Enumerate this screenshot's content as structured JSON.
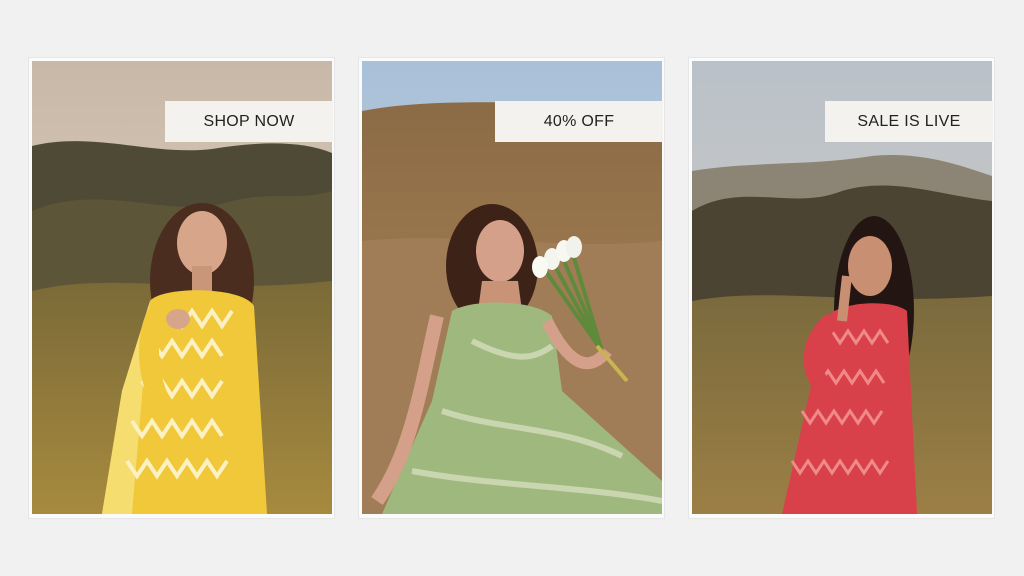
{
  "cards": [
    {
      "label": "SHOP NOW",
      "dress_color": "#f1c83a",
      "accent": "#f7e8a0"
    },
    {
      "label": "40% OFF",
      "dress_color": "#9fb87d",
      "accent": "#c9d6b0"
    },
    {
      "label": "SALE IS LIVE",
      "dress_color": "#d8414a",
      "accent": "#f08a8a"
    }
  ]
}
